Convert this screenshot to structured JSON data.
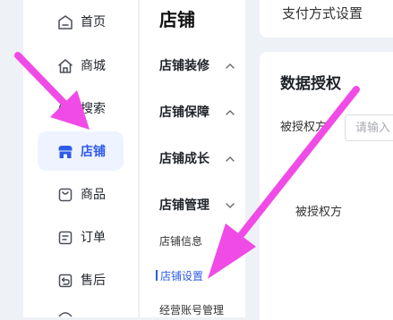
{
  "sidebar": {
    "items": [
      {
        "label": "首页",
        "icon": "home-icon"
      },
      {
        "label": "商城",
        "icon": "store-icon"
      },
      {
        "label": "搜索",
        "icon": "search-icon"
      },
      {
        "label": "店铺",
        "icon": "shop-icon",
        "active": true
      },
      {
        "label": "商品",
        "icon": "product-bag-icon"
      },
      {
        "label": "订单",
        "icon": "order-icon"
      },
      {
        "label": "售后",
        "icon": "after-sales-icon"
      }
    ]
  },
  "submenu": {
    "title": "店铺",
    "groups": [
      {
        "label": "店铺装修",
        "expanded": false
      },
      {
        "label": "店铺保障",
        "expanded": false
      },
      {
        "label": "店铺成长",
        "expanded": false
      },
      {
        "label": "店铺管理",
        "expanded": true
      }
    ],
    "items": [
      {
        "label": "店铺信息"
      },
      {
        "label": "店铺设置",
        "active": true
      },
      {
        "label": "经营账号管理"
      }
    ]
  },
  "main": {
    "top_card_title": "支付方式设置",
    "section_title": "数据授权",
    "field_label": "被授权方",
    "field_placeholder": "请输入",
    "column_header": "被授权方"
  },
  "colors": {
    "accent": "#2f5bea",
    "annotation": "#f04be6",
    "active_bg": "#eef3ff"
  }
}
